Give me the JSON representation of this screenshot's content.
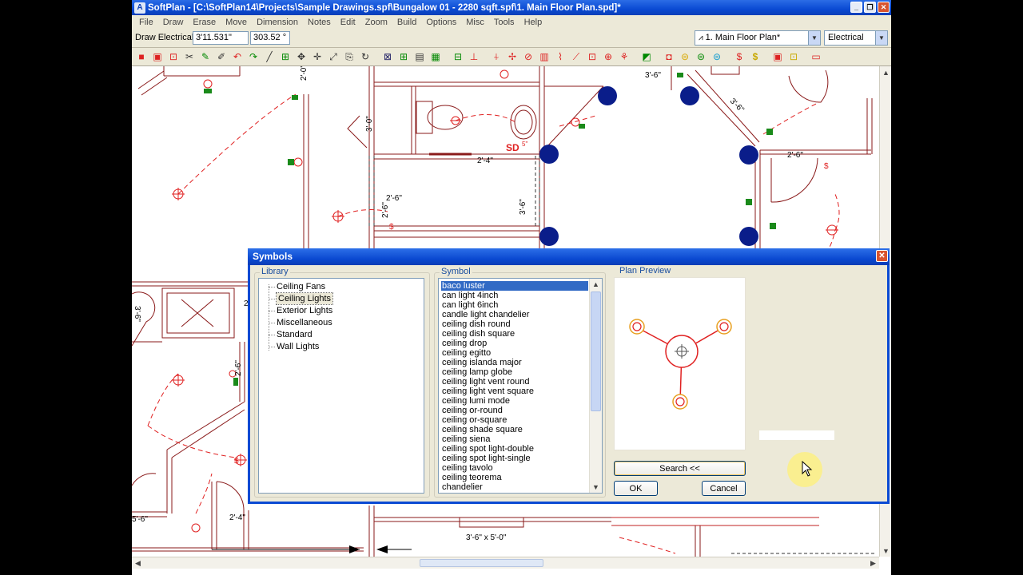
{
  "window": {
    "title": "SoftPlan - [C:\\SoftPlan14\\Projects\\Sample Drawings.spf\\Bungalow 01 - 2280 sqft.spf\\1. Main Floor Plan.spd]*",
    "app_icon_letter": "A"
  },
  "menu": [
    "File",
    "Draw",
    "Erase",
    "Move",
    "Dimension",
    "Notes",
    "Edit",
    "Zoom",
    "Build",
    "Options",
    "Misc",
    "Tools",
    "Help"
  ],
  "status": {
    "mode": "Draw Electrical",
    "length": "3'11.531\"",
    "angle": "303.52 °",
    "plan_select": "1. Main Floor Plan*",
    "layer_select": "Electrical"
  },
  "drawing": {
    "dims": [
      "3'-6\"",
      "3'-0\"",
      "2'-4\"",
      "2'-6\"",
      "3'-6\"",
      "3'-6\"",
      "2'-6\"",
      "2'-4\"",
      "2'-6\"",
      "3'-6\" x 5'-0\"",
      "5'-6\"",
      "2'-0\"",
      "3'-6\"",
      "2'-4\"",
      "2'-6\""
    ],
    "small_labels": [
      "SD",
      "5\""
    ]
  },
  "dialog": {
    "title": "Symbols",
    "library_label": "Library",
    "library_items": [
      "Ceiling Fans",
      "Ceiling Lights",
      "Exterior Lights",
      "Miscellaneous",
      "Standard",
      "Wall Lights"
    ],
    "library_selected": "Ceiling Lights",
    "symbol_label": "Symbol",
    "symbols": [
      "baco luster",
      "can light 4inch",
      "can light 6inch",
      "candle light chandelier",
      "ceiling dish round",
      "ceiling dish square",
      "ceiling drop",
      "ceiling egitto",
      "ceiling islanda major",
      "ceiling lamp globe",
      "ceiling light vent round",
      "ceiling light vent square",
      "ceiling lumi mode",
      "ceiling or-round",
      "ceiling or-square",
      "ceiling shade square",
      "ceiling siena",
      "ceiling spot light-double",
      "ceiling spot light-single",
      "ceiling tavolo",
      "ceiling teorema",
      "chandelier"
    ],
    "symbol_selected": "baco luster",
    "preview_label": "Plan Preview",
    "search_button": "Search <<",
    "ok_button": "OK",
    "cancel_button": "Cancel"
  },
  "colors": {
    "title_bar": "#0a4ad3",
    "dialog_bg": "#ece9d8",
    "selection": "#316ac5",
    "wall": "#8a1a1a",
    "electrical": "#e02020",
    "symbol_fill": "#0a1d8a"
  }
}
